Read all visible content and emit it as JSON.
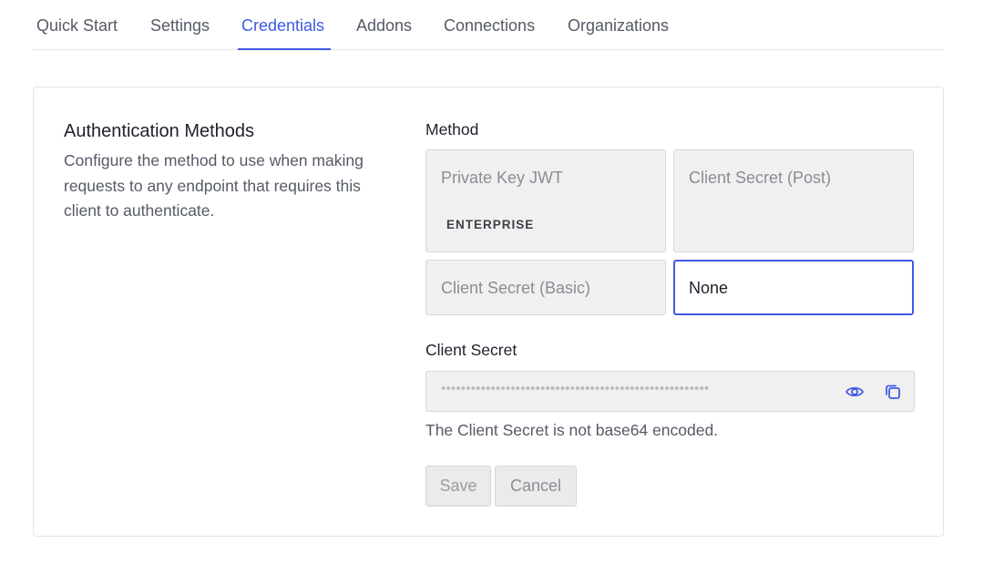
{
  "tabs": [
    {
      "label": "Quick Start"
    },
    {
      "label": "Settings"
    },
    {
      "label": "Credentials",
      "active": true
    },
    {
      "label": "Addons"
    },
    {
      "label": "Connections"
    },
    {
      "label": "Organizations"
    }
  ],
  "auth": {
    "title": "Authentication Methods",
    "description": "Configure the method to use when making requests to any endpoint that requires this client to authenticate."
  },
  "method": {
    "label": "Method",
    "options": [
      {
        "label": "Private Key JWT",
        "badge": "ENTERPRISE"
      },
      {
        "label": "Client Secret (Post)"
      },
      {
        "label": "Client Secret (Basic)"
      },
      {
        "label": "None",
        "selected": true
      }
    ]
  },
  "client_secret": {
    "label": "Client Secret",
    "masked_value": "••••••••••••••••••••••••••••••••••••••••••••••••••••••",
    "hint": "The Client Secret is not base64 encoded."
  },
  "buttons": {
    "save": "Save",
    "cancel": "Cancel"
  },
  "colors": {
    "accent": "#3f59e4",
    "disabled_bg": "#f0f0f0"
  }
}
